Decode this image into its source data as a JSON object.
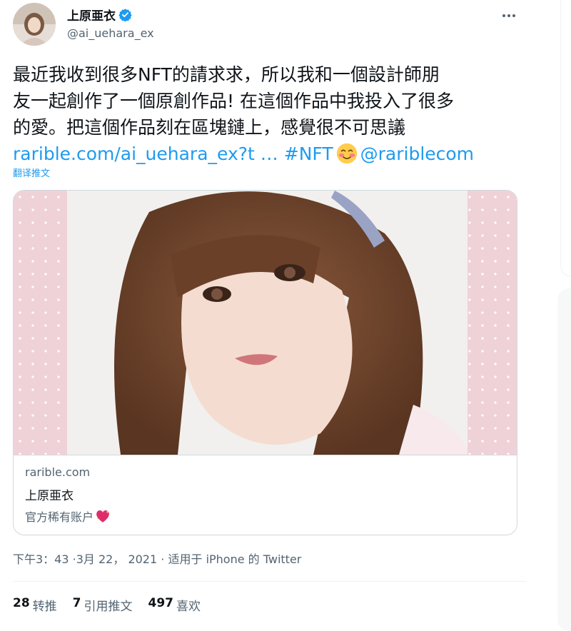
{
  "author": {
    "name": "上原亜衣",
    "handle": "@ai_uehara_ex",
    "verified": true
  },
  "tweet": {
    "text_line1": "最近我收到很多NFT的請求求，所以我和一個設計師朋",
    "text_line2": "友一起創作了一個原創作品! 在這個作品中我投入了很多",
    "text_line3": "的愛。把這個作品刻在區塊鏈上，感覺很不可思議",
    "link_url": "rarible.com/ai_uehara_ex?t …",
    "hashtag": "#NFT",
    "emoji": "blushing-face",
    "mention": "@rariblecom",
    "translate_label": "翻译推文"
  },
  "card": {
    "domain": "rarible.com",
    "title": "上原亜衣",
    "description": "官方稀有账户",
    "description_emoji": "sparkling-heart"
  },
  "meta": {
    "time": "下午3：43",
    "date": "3月 22， 2021",
    "source_prefix": "适用于",
    "source": "iPhone 的 Twitter"
  },
  "stats": {
    "retweets_count": "28",
    "retweets_label": "转推",
    "quotes_count": "7",
    "quotes_label": "引用推文",
    "likes_count": "497",
    "likes_label": "喜欢"
  },
  "colors": {
    "link": "#1d9bf0",
    "secondary_text": "#536471",
    "border": "#cfd9de"
  }
}
